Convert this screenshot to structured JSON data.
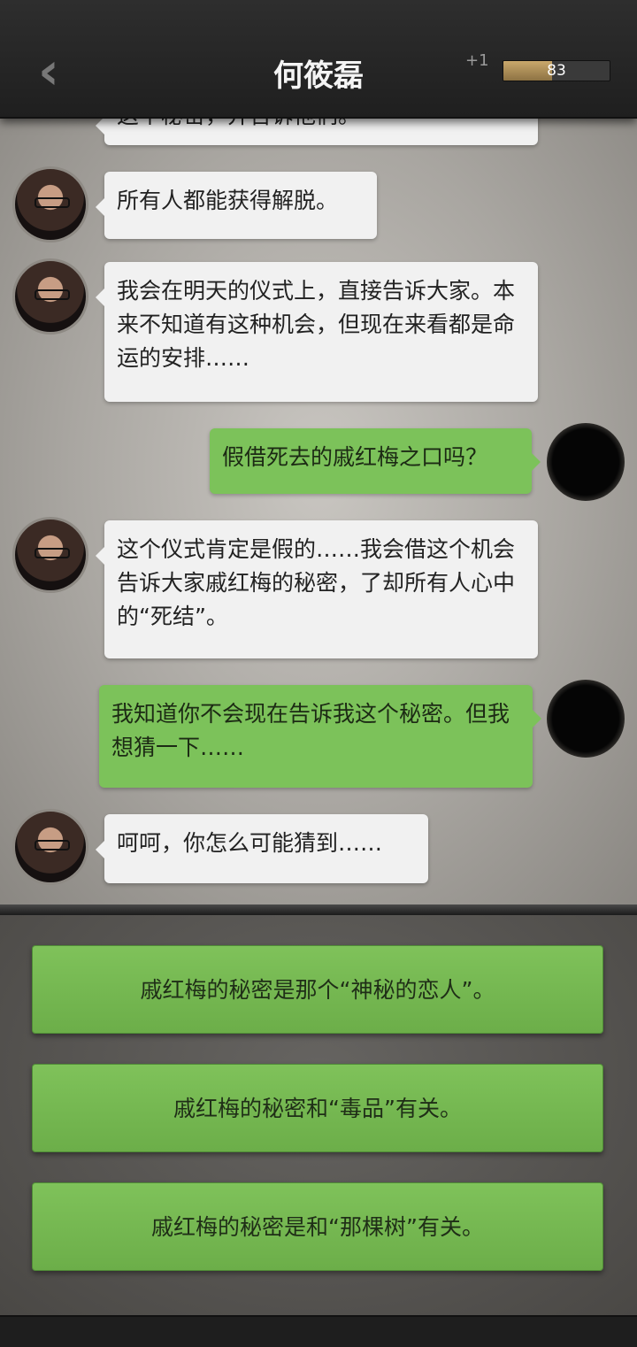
{
  "header": {
    "back_icon": "‹",
    "title": "何筱磊",
    "plus": "+1",
    "progress_value": "83",
    "progress_fraction": 0.46
  },
  "messages": [
    {
      "side": "left",
      "text": "这个秘密，并告诉他们。",
      "partial": true
    },
    {
      "side": "left",
      "text": "所有人都能获得解脱。"
    },
    {
      "side": "left",
      "text": "我会在明天的仪式上，直接告诉大家。本来不知道有这种机会，但现在来看都是命运的安排……"
    },
    {
      "side": "right",
      "text": "假借死去的戚红梅之口吗？"
    },
    {
      "side": "left",
      "text": "这个仪式肯定是假的……我会借这个机会告诉大家戚红梅的秘密，了却所有人心中的“死结”。"
    },
    {
      "side": "right",
      "text": "我知道你不会现在告诉我这个秘密。但我想猜一下……"
    },
    {
      "side": "left",
      "text": "呵呵，你怎么可能猜到……"
    }
  ],
  "options": [
    {
      "label": "戚红梅的秘密是那个“神秘的恋人”。"
    },
    {
      "label": "戚红梅的秘密和“毒品”有关。"
    },
    {
      "label": "戚红梅的秘密是和“那棵树”有关。"
    }
  ],
  "colors": {
    "accent_green": "#7cc25a",
    "bubble_white": "#f1f1f1",
    "progress": "#c9a86c"
  }
}
